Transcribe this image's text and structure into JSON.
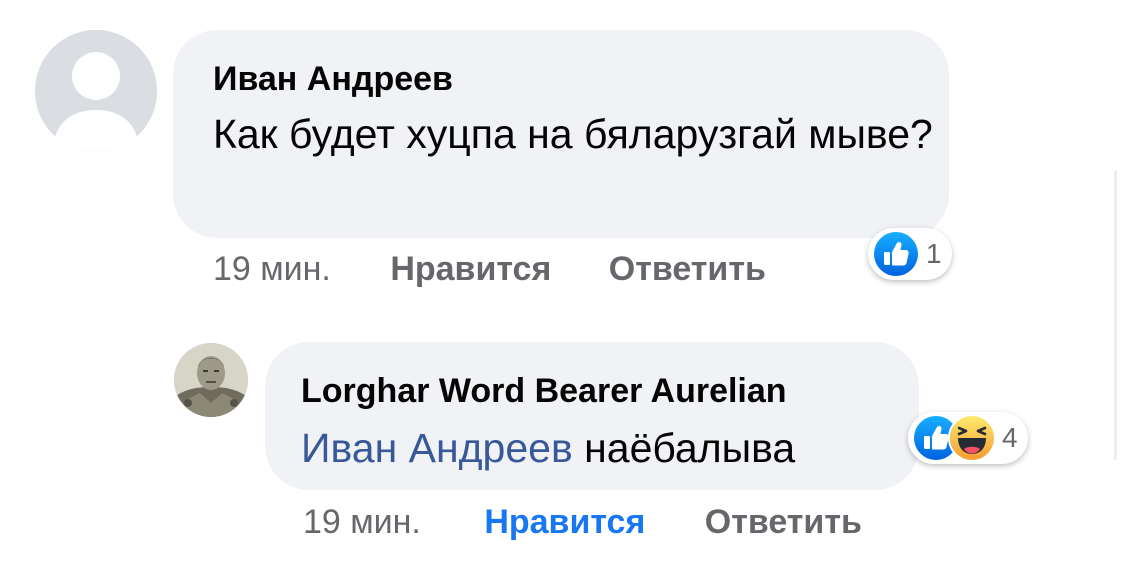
{
  "comments": [
    {
      "author": "Иван Андреев",
      "text": "Как будет хуцпа на бяларузгай мыве?",
      "time": "19 мин.",
      "like_label": "Нравится",
      "reply_label": "Ответить",
      "reactions": {
        "icons": [
          "like-icon"
        ],
        "count": "1"
      }
    },
    {
      "author": "Lorghar Word Bearer Aurelian",
      "mention": "Иван Андреев",
      "text": " наёбалыва",
      "time": "19 мин.",
      "like_label": "Нравится",
      "reply_label": "Ответить",
      "liked": true,
      "reactions": {
        "icons": [
          "like-icon",
          "haha-icon"
        ],
        "count": "4"
      }
    }
  ],
  "colors": {
    "like_blue": "#1877f2",
    "mention_blue": "#385898",
    "bubble_bg": "#f0f2f5",
    "meta_gray": "#65676b"
  }
}
